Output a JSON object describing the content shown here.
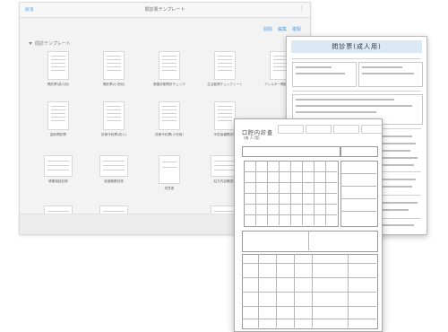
{
  "window": {
    "back_label": "戻る",
    "title": "問診票テンプレート",
    "menu_label": "⋮"
  },
  "toolbar": [
    "削除",
    "編集",
    "複製"
  ],
  "section": {
    "label": "問診テンプレート"
  },
  "templates": [
    {
      "label": "問診票(成人用)"
    },
    {
      "label": "問診票(小児用)"
    },
    {
      "label": "健康診断問診チェック"
    },
    {
      "label": "生活習慣チェックシート"
    },
    {
      "label": "アレルギー問診シート"
    },
    {
      "label": "歯科問診票"
    },
    {
      "label": "診療予約票(成人)"
    },
    {
      "label": "診療予約票(小児用)"
    },
    {
      "label": "予防接種問診票"
    },
    {
      "label": ""
    },
    {
      "label": "健康相談記録"
    },
    {
      "label": "経過観察記録"
    },
    {
      "label": "同意書"
    },
    {
      "label": "処方内容確認書"
    },
    {
      "label": ""
    }
  ],
  "doc_a": {
    "title": "問診票(成人用)"
  },
  "doc_b": {
    "title": "口腔内診査",
    "subtitle": "(成 人 用)"
  }
}
